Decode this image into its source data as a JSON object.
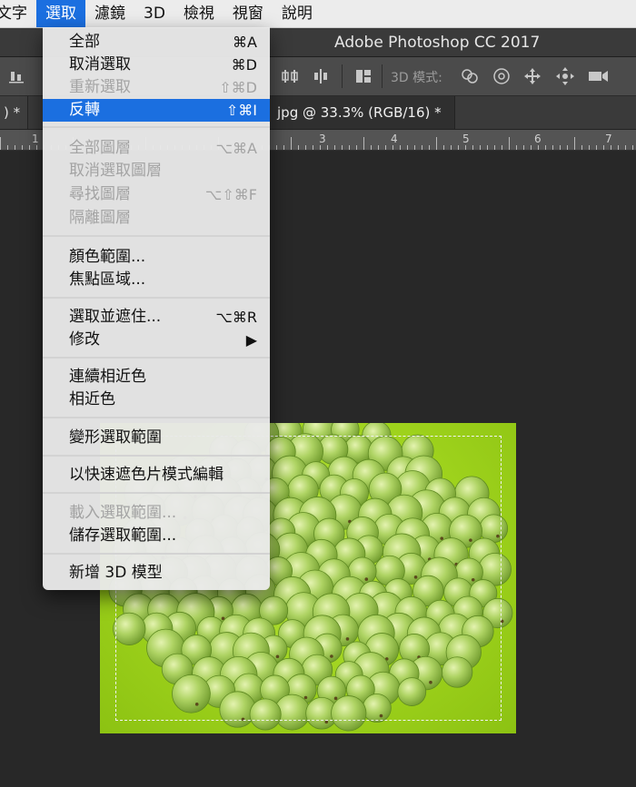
{
  "menubar": {
    "items": [
      "文字",
      "選取",
      "濾鏡",
      "3D",
      "檢視",
      "視窗",
      "說明"
    ],
    "active_index": 1
  },
  "titlebar": {
    "title": "Adobe Photoshop CC 2017"
  },
  "optionsbar": {
    "mode_label": "3D 模式:"
  },
  "tabs": {
    "left": ") *",
    "close": "×",
    "right": "jpg @ 33.3% (RGB/16) *"
  },
  "ruler": {
    "numbers": [
      "1",
      "3",
      "4",
      "5",
      "6",
      "7"
    ]
  },
  "menu": {
    "items": [
      {
        "label": "全部",
        "shortcut": "⌘A",
        "enabled": true
      },
      {
        "label": "取消選取",
        "shortcut": "⌘D",
        "enabled": true
      },
      {
        "label": "重新選取",
        "shortcut": "⇧⌘D",
        "enabled": false
      },
      {
        "label": "反轉",
        "shortcut": "⇧⌘I",
        "enabled": true,
        "highlighted": true
      },
      {
        "label": "全部圖層",
        "shortcut": "⌥⌘A",
        "enabled": false
      },
      {
        "label": "取消選取圖層",
        "shortcut": "",
        "enabled": false
      },
      {
        "label": "尋找圖層",
        "shortcut": "⌥⇧⌘F",
        "enabled": false
      },
      {
        "label": "隔離圖層",
        "shortcut": "",
        "enabled": false
      },
      {
        "label": "顏色範圍...",
        "shortcut": "",
        "enabled": true
      },
      {
        "label": "焦點區域...",
        "shortcut": "",
        "enabled": true
      },
      {
        "label": "選取並遮住...",
        "shortcut": "⌥⌘R",
        "enabled": true
      },
      {
        "label": "修改",
        "shortcut": "▶",
        "enabled": true
      },
      {
        "label": "連續相近色",
        "shortcut": "",
        "enabled": true
      },
      {
        "label": "相近色",
        "shortcut": "",
        "enabled": true
      },
      {
        "label": "變形選取範圍",
        "shortcut": "",
        "enabled": true
      },
      {
        "label": "以快速遮色片模式編輯",
        "shortcut": "",
        "enabled": true
      },
      {
        "label": "載入選取範圍...",
        "shortcut": "",
        "enabled": false
      },
      {
        "label": "儲存選取範圍...",
        "shortcut": "",
        "enabled": true
      },
      {
        "label": "新增 3D 模型",
        "shortcut": "",
        "enabled": true
      }
    ]
  },
  "colors": {
    "menu_highlight": "#1b6fe0",
    "app_bg": "#282828",
    "image_green": "#9ed21c"
  }
}
